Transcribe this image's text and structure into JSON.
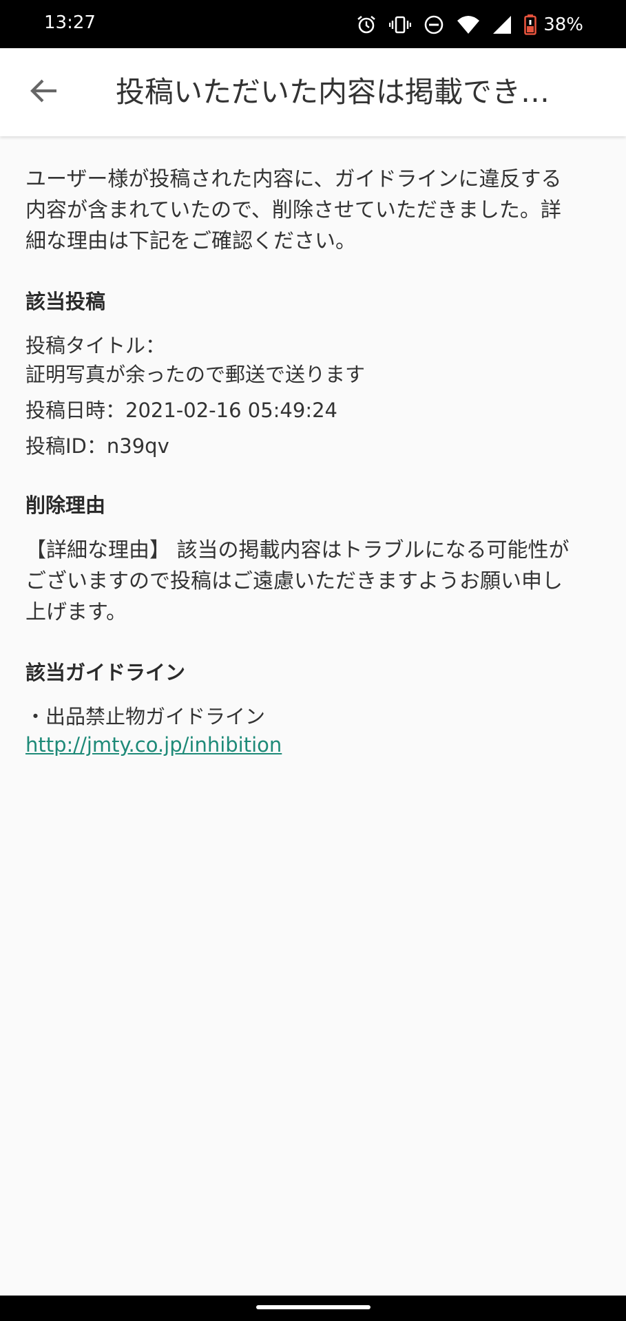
{
  "status_bar": {
    "time": "13:27",
    "battery_percent": "38%",
    "icons": [
      "alarm-icon",
      "vibrate-icon",
      "do-not-disturb-icon",
      "wifi-icon",
      "signal-icon",
      "battery-icon"
    ]
  },
  "app_bar": {
    "back_icon": "arrow-left-icon",
    "title": "投稿いただいた内容は掲載でき…"
  },
  "intro": {
    "line1": "ユーザー様が投稿された内容に、ガイドラインに違反する",
    "line2": "内容が含まれていたので、削除させていただきました。詳",
    "line3": "細な理由は下記をご確認ください。"
  },
  "post_section": {
    "heading": "該当投稿",
    "title_label": "投稿タイトル：",
    "title_value": "証明写真が余ったので郵送で送ります",
    "datetime": "投稿日時：2021-02-16 05:49:24",
    "post_id": "投稿ID：n39qv"
  },
  "reason_section": {
    "heading": "削除理由",
    "line1": "【詳細な理由】 該当の掲載内容はトラブルになる可能性が",
    "line2": "ございますので投稿はご遠慮いただきますようお願い申し",
    "line3": "上げます。"
  },
  "guideline_section": {
    "heading": "該当ガイドライン",
    "item": "・出品禁止物ガイドライン",
    "link": "http://jmty.co.jp/inhibition"
  },
  "colors": {
    "link": "#1e8a78",
    "background": "#fafafa",
    "battery_low": "#e5533d"
  }
}
